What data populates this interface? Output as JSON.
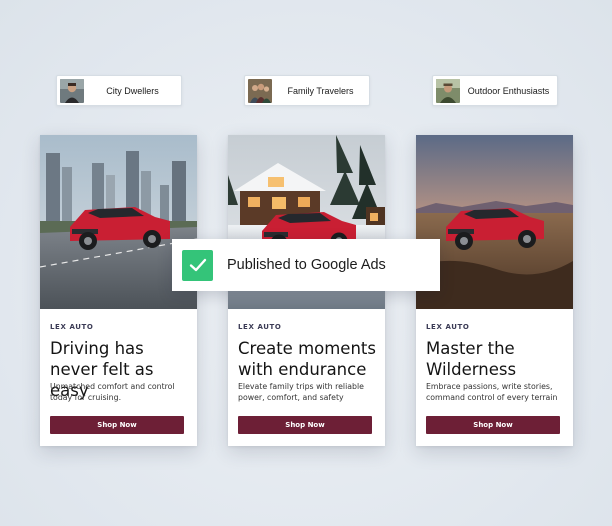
{
  "personas": [
    {
      "label": "City Dwellers",
      "icon": "city-dwellers-avatar"
    },
    {
      "label": "Family Travelers",
      "icon": "family-travelers-avatar"
    },
    {
      "label": "Outdoor Enthusiasts",
      "icon": "outdoor-enthusiasts-avatar"
    }
  ],
  "cards": [
    {
      "brand": "LEX AUTO",
      "headline": "Driving has never felt as easy",
      "body": "Unmatched comfort and control today for cruising.",
      "cta": "Shop Now",
      "scene": "city-highway"
    },
    {
      "brand": "LEX AUTO",
      "headline": "Create moments with endurance",
      "body": "Elevate family trips with reliable power, comfort, and safety",
      "cta": "Shop Now",
      "scene": "snowy-cabin"
    },
    {
      "brand": "LEX AUTO",
      "headline": "Master the Wilderness",
      "body": "Embrace passions, write stories, command control of every terrain",
      "cta": "Shop Now",
      "scene": "sunset-prairie"
    }
  ],
  "toast": {
    "message": "Published to Google Ads",
    "icon": "check-icon"
  },
  "colors": {
    "cta": "#6d1f36",
    "check": "#34c479",
    "car": "#c91f33",
    "background": "#e3e9ef"
  }
}
